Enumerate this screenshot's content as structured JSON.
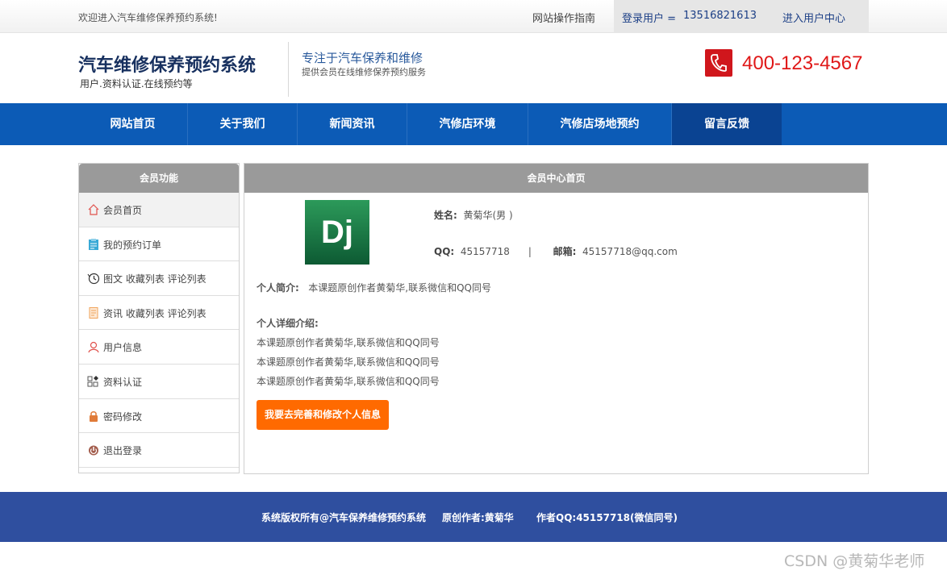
{
  "topbar": {
    "welcome": "欢迎进入汽车维修保养预约系统!",
    "guide": "网站操作指南",
    "login_label": "登录用户 =",
    "username": "13516821613",
    "user_center": "进入用户中心"
  },
  "header": {
    "title": "汽车维修保养预约系统",
    "subtitle": "用户.资料认证.在线预约等",
    "slogan_main": "专注于汽车保养和维修",
    "slogan_sub": "提供会员在线维修保养预约服务",
    "phone": "400-123-4567"
  },
  "nav": {
    "items": [
      {
        "label": "网站首页"
      },
      {
        "label": "关于我们"
      },
      {
        "label": "新闻资讯"
      },
      {
        "label": "汽修店环境"
      },
      {
        "label": "汽修店场地预约"
      },
      {
        "label": "留言反馈"
      }
    ]
  },
  "sidebar": {
    "title": "会员功能",
    "items": [
      {
        "label": "会员首页",
        "icon": "home-icon"
      },
      {
        "label": "我的预约订单",
        "icon": "clipboard-icon"
      },
      {
        "label": "图文 收藏列表 评论列表",
        "icon": "history-icon"
      },
      {
        "label": "资讯 收藏列表 评论列表",
        "icon": "document-icon"
      },
      {
        "label": "用户信息",
        "icon": "user-icon"
      },
      {
        "label": "资料认证",
        "icon": "grid-icon"
      },
      {
        "label": "密码修改",
        "icon": "lock-icon"
      },
      {
        "label": "退出登录",
        "icon": "power-icon"
      }
    ]
  },
  "main": {
    "title": "会员中心首页",
    "avatar_text": "Dj",
    "name_label": "姓名:",
    "name_value": "黄菊华(男 )",
    "qq_label": "QQ:",
    "qq_value": "45157718",
    "separator": "|",
    "email_label": "邮箱:",
    "email_value": "45157718@qq.com",
    "intro_label": "个人简介:",
    "intro_value": "本课题原创作者黄菊华,联系微信和QQ同号",
    "detail_label": "个人详细介绍:",
    "detail_lines": [
      "本课题原创作者黄菊华,联系微信和QQ同号",
      "本课题原创作者黄菊华,联系微信和QQ同号",
      "本课题原创作者黄菊华,联系微信和QQ同号"
    ],
    "edit_button": "我要去完善和修改个人信息"
  },
  "footer": {
    "copyright": "系统版权所有@汽车保养维修预约系统",
    "author": "原创作者:黄菊华",
    "qq": "作者QQ:45157718(微信同号)"
  },
  "watermark": "CSDN @黄菊华老师",
  "colors": {
    "nav_bg": "#0c5bb6",
    "nav_active": "#0a4392",
    "footer_bg": "#2f4f9f",
    "phone_red": "#e01818",
    "button_orange": "#ff6a00"
  }
}
